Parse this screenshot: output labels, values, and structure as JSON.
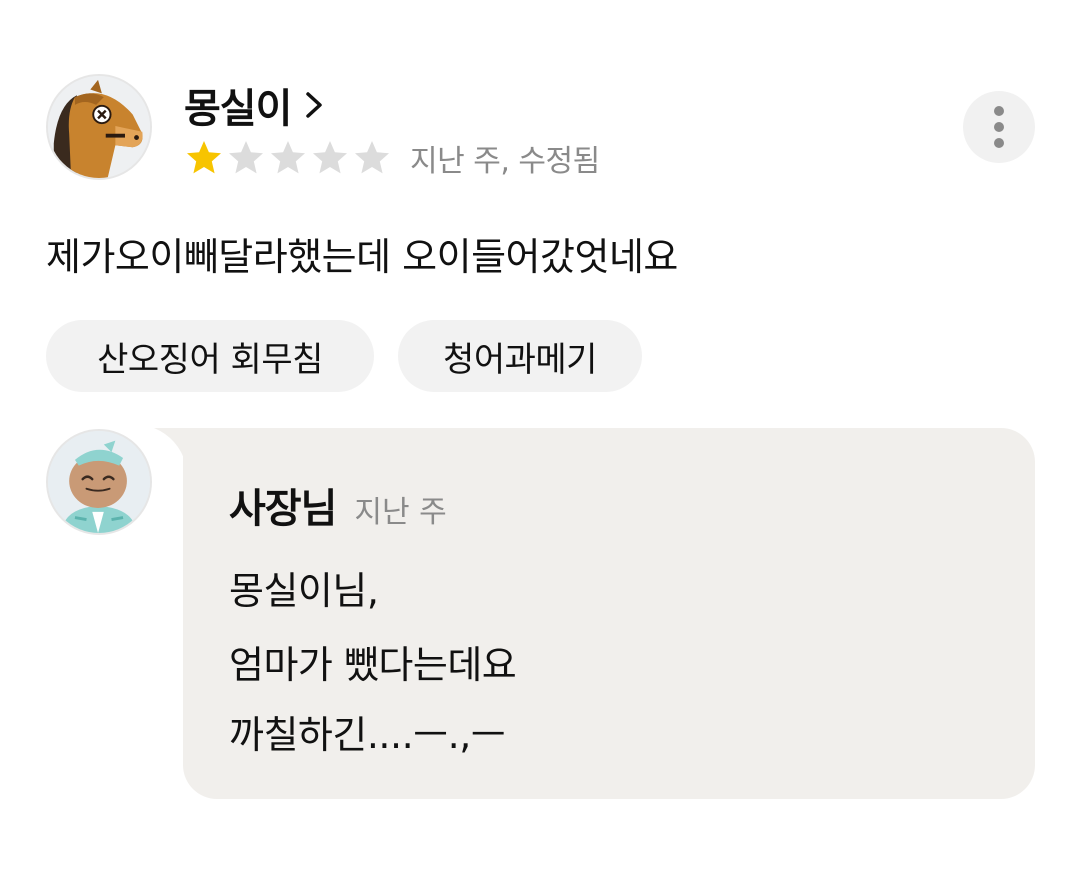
{
  "review": {
    "author": "몽실이",
    "rating": 1,
    "rating_max": 5,
    "meta": "지난 주, 수정됨",
    "text": "제가오이빼달라했는데 오이들어갔엇네요",
    "menu_tags": [
      "산오징어 회무침",
      "청어과메기"
    ]
  },
  "reply": {
    "author": "사장님",
    "time": "지난 주",
    "lines": [
      "몽실이님,",
      "엄마가 뺐다는데요",
      "까칠하긴....ㅡ.,ㅡ"
    ]
  },
  "icons": {
    "reviewer_avatar": "horse-avatar-icon",
    "owner_avatar": "chef-avatar-icon",
    "chevron": "chevron-right-icon",
    "more": "more-vertical-icon",
    "star_filled": "star-filled-icon",
    "star_empty": "star-empty-icon"
  },
  "colors": {
    "star_filled": "#f7c400",
    "star_empty": "#dcdcdc",
    "meta_text": "#8a8a8a",
    "chip_bg": "#f2f2f2",
    "reply_bg": "#f1efec"
  }
}
